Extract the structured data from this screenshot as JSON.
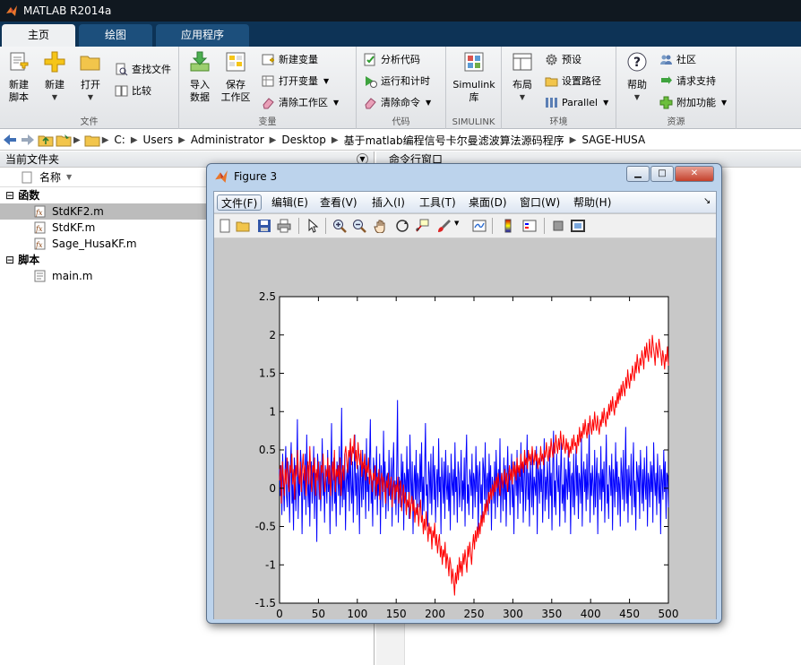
{
  "app": {
    "title": "MATLAB R2014a"
  },
  "ribbon": {
    "tabs": [
      "主页",
      "绘图",
      "应用程序"
    ],
    "sections": {
      "file": {
        "caption": "文件",
        "new_script": "新建\n脚本",
        "new": "新建",
        "open": "打开",
        "find_files": "查找文件",
        "compare": "比较"
      },
      "variable": {
        "caption": "变量",
        "import": "导入\n数据",
        "save_ws": "保存\n工作区",
        "new_var": "新建变量",
        "open_var": "打开变量",
        "clear_ws": "清除工作区"
      },
      "code": {
        "caption": "代码",
        "analyze": "分析代码",
        "run_time": "运行和计时",
        "clear_cmd": "清除命令"
      },
      "simulink": {
        "caption": "SIMULINK",
        "lib": "Simulink\n库"
      },
      "env": {
        "caption": "环境",
        "layout": "布局",
        "prefs": "预设",
        "set_path": "设置路径",
        "parallel": "Parallel"
      },
      "resources": {
        "caption": "资源",
        "help": "帮助",
        "community": "社区",
        "support": "请求支持",
        "addons": "附加功能"
      }
    }
  },
  "address": {
    "parts": [
      "C:",
      "Users",
      "Administrator",
      "Desktop",
      "基于matlab编程信号卡尔曼滤波算法源码程序",
      "SAGE-HUSA"
    ]
  },
  "file_panel": {
    "title": "当前文件夹",
    "col_name": "名称",
    "groups": [
      {
        "label": "函数",
        "items": [
          "StdKF2.m",
          "StdKF.m",
          "Sage_HusaKF.m"
        ]
      },
      {
        "label": "脚本",
        "items": [
          "main.m"
        ]
      }
    ]
  },
  "command_panel": {
    "title": "命令行窗口"
  },
  "figure": {
    "title": "Figure 3",
    "menu": [
      "文件(F)",
      "编辑(E)",
      "查看(V)",
      "插入(I)",
      "工具(T)",
      "桌面(D)",
      "窗口(W)",
      "帮助(H)"
    ]
  },
  "chart_data": {
    "type": "line",
    "xlim": [
      0,
      500
    ],
    "ylim": [
      -1.5,
      2.5
    ],
    "xticks": [
      0,
      50,
      100,
      150,
      200,
      250,
      300,
      350,
      400,
      450,
      500
    ],
    "yticks": [
      -1.5,
      -1,
      -0.5,
      0,
      0.5,
      1,
      1.5,
      2,
      2.5
    ],
    "series": [
      {
        "color": "#0000ff",
        "values": [
          0.25,
          -0.1,
          0.3,
          -0.35,
          0.45,
          0.05,
          -0.3,
          0.2,
          0.55,
          -0.1,
          -0.25,
          0.35,
          0.1,
          -0.45,
          0.3,
          0.6,
          -0.2,
          0.05,
          -0.55,
          0.4,
          0.2,
          -0.3,
          0.1,
          0.9,
          -0.4,
          0.15,
          -0.1,
          0.5,
          0.3,
          -0.6,
          0.05,
          0.2,
          -0.15,
          0.45,
          -0.35,
          0.7,
          0.1,
          -0.25,
          0.3,
          -0.5,
          0.15,
          0.35,
          -0.2,
          0.05,
          0.55,
          -0.4,
          0.2,
          0.1,
          -0.7,
          0.45,
          0.25,
          -0.15,
          0.35,
          -0.3,
          0.05,
          0.65,
          -0.1,
          0.2,
          -0.45,
          0.3,
          0.1,
          -0.2,
          0.5,
          -0.05,
          0.3,
          -0.6,
          0.15,
          0.85,
          -0.3,
          0.1,
          0.4,
          -0.2,
          0.05,
          -0.5,
          0.35,
          0.2,
          -0.1,
          0.55,
          -0.35,
          0.15,
          1.05,
          -0.25,
          0.3,
          -0.15,
          0.45,
          -0.55,
          0.1,
          0.25,
          -0.05,
          0.4,
          -0.3,
          0.6,
          0.05,
          -0.2,
          0.35,
          -0.45,
          0.15,
          0.7,
          -0.1,
          0.2,
          -0.35,
          0.3,
          0.1,
          -0.6,
          0.45,
          0.05,
          -0.25,
          0.5,
          -0.15,
          0.3,
          0.2,
          -0.4,
          0.65,
          -0.05,
          0.15,
          -0.3,
          0.35,
          0.9,
          -0.2,
          0.1,
          -0.5,
          0.4,
          0.25,
          -0.15,
          0.05,
          0.55,
          -0.35,
          0.2,
          -0.1,
          0.45,
          -0.6,
          0.3,
          0.1,
          -0.25,
          0.75,
          -0.05,
          0.35,
          -0.4,
          0.15,
          0.2,
          -0.3,
          0.5,
          0.05,
          -0.15,
          0.4,
          -0.5,
          0.25,
          0.6,
          -0.2,
          0.1,
          -0.35,
          0.3,
          1.15,
          -0.45,
          0.15,
          0.05,
          -0.25,
          0.45,
          -0.1,
          0.35,
          -0.55,
          0.2,
          0.1,
          -0.3,
          0.55,
          -0.05,
          0.25,
          -0.4,
          0.7,
          0.15,
          -0.2,
          0.35,
          -0.6,
          0.05,
          0.3,
          -0.15,
          0.5,
          -0.35,
          0.2,
          0.1,
          -0.25,
          0.45,
          -0.05,
          0.6,
          -0.4,
          0.15,
          -0.3,
          0.25,
          0.85,
          -0.1,
          0.05,
          -0.5,
          0.35,
          0.2,
          -0.2,
          0.45,
          -0.35,
          0.1,
          0.55,
          -0.15,
          0.3,
          -0.45,
          0.05,
          0.25,
          -0.25,
          0.65,
          -0.05,
          0.15,
          -0.6,
          0.4,
          0.1,
          -0.2,
          0.35,
          -0.4,
          0.5,
          0.05,
          -0.15,
          0.3,
          -0.3,
          0.2,
          -0.55,
          0.45,
          0.1,
          -0.1,
          0.25,
          -0.35,
          0.6,
          -0.05,
          0.15,
          -0.45,
          0.35,
          0.2,
          -0.25,
          0.05,
          0.5,
          -0.3,
          0.1,
          -0.15,
          0.4,
          -0.5,
          0.3,
          0.7,
          -0.2,
          0.05,
          -0.35,
          0.25,
          0.15,
          -0.1,
          0.45,
          -0.4,
          0.2,
          0.1,
          -0.25,
          0.55,
          -0.05,
          0.3,
          -0.6,
          0.15,
          0.35,
          -0.2,
          0.05,
          -0.45,
          0.4,
          0.25,
          -0.15,
          0.6,
          -0.3,
          0.1,
          0.2,
          -0.35,
          0.45,
          -0.05,
          0.3,
          -0.55,
          0.15,
          0.05,
          -0.2,
          0.35,
          -0.4,
          0.5,
          0.1,
          -0.25,
          0.25,
          -0.1,
          0.65,
          -0.45,
          0.2,
          0.05,
          -0.3,
          0.4,
          -0.15,
          0.3,
          -0.5,
          0.1,
          0.55,
          -0.05,
          0.2,
          -0.35,
          0.15,
          0.45,
          -0.25,
          0.05,
          -0.6,
          0.35,
          0.2,
          -0.1,
          0.5,
          -0.4,
          0.25,
          0.1,
          -0.2,
          0.6,
          -0.05,
          0.3,
          -0.45,
          0.15,
          0.4,
          -0.3,
          0.05,
          0.7,
          -0.15,
          0.2,
          -0.5,
          0.35,
          0.1,
          -0.25,
          0.45,
          -0.35,
          0.15,
          0.05,
          -0.1,
          0.55,
          -0.6,
          0.3,
          0.2,
          -0.2,
          0.4,
          -0.05,
          0.25,
          -0.45,
          0.1,
          0.65,
          -0.3,
          0.15,
          -0.15,
          0.35,
          0.05,
          -0.4,
          0.5,
          -0.1,
          0.2,
          -0.55,
          0.3,
          0.75,
          -0.25,
          0.1,
          -0.35,
          0.45,
          0.15,
          -0.05,
          0.3,
          -0.5,
          0.2,
          0.6,
          -0.2,
          0.05,
          -0.3,
          0.4,
          -0.45,
          0.25,
          0.1,
          -0.15,
          0.5,
          -0.05,
          0.35,
          -0.6,
          0.15,
          0.2,
          -0.25,
          0.45,
          -0.35,
          0.05,
          0.55,
          -0.1,
          0.3,
          -0.4,
          0.2,
          0.1,
          -0.2,
          0.65,
          -0.5,
          0.15,
          0.35,
          -0.05,
          0.25,
          -0.3,
          0.45,
          -0.15,
          0.1,
          0.85,
          -0.45,
          0.2,
          -0.1,
          0.3,
          0.05,
          -0.35,
          0.5,
          -0.25,
          0.15,
          0.4,
          -0.6,
          0.2,
          0.1,
          -0.15,
          0.55,
          -0.3,
          0.25,
          -0.05,
          0.35,
          -0.45,
          0.15,
          0.7,
          -0.2,
          0.05,
          -0.4,
          0.3,
          0.2,
          -0.1,
          0.45,
          -0.55,
          0.25,
          0.1,
          -0.25,
          0.6,
          -0.05,
          0.35,
          -0.35,
          0.15,
          0.05,
          -0.5,
          0.4,
          0.2,
          -0.15,
          0.5,
          -0.3,
          0.1,
          0.8,
          -0.2,
          0.25,
          -0.45,
          0.3,
          0.05,
          -0.1,
          0.45,
          -0.35,
          0.15,
          0.6,
          -0.25,
          0.1,
          -0.55,
          0.35,
          0.2,
          -0.05,
          0.3,
          -0.4,
          0.5,
          0.15,
          -0.2,
          0.25,
          -0.3,
          0.4,
          0.05,
          -0.15,
          0.55,
          -0.5,
          0.2,
          0.1,
          -0.25,
          0.35,
          -0.05,
          0.3,
          -0.45,
          0.6,
          0.15,
          -0.1,
          0.2,
          -0.35,
          0.45,
          0.05,
          -0.2,
          0.3,
          -0.6,
          0.25,
          0.1,
          -0.15,
          0.5,
          -0.05,
          0.35,
          -0.4,
          0.2,
          0.15,
          -0.25
        ]
      },
      {
        "color": "#ff0000",
        "values": [
          0.1,
          0.3,
          -0.2,
          0.35,
          0.15,
          -0.1,
          0.25,
          0.05,
          0.4,
          0.1,
          -0.05,
          0.3,
          0.2,
          0.45,
          0.05,
          0.25,
          -0.15,
          0.3,
          0.15,
          0.5,
          0.2,
          0.05,
          0.35,
          -0.05,
          0.25,
          0.45,
          0.1,
          0.3,
          -0.1,
          0.2,
          0.35,
          0.05,
          0.55,
          0.15,
          -0.05,
          0.3,
          0.2,
          0.4,
          -0.1,
          0.25,
          0.1,
          0.35,
          0.05,
          -0.15,
          0.3,
          0.2,
          0.45,
          0.1,
          -0.05,
          0.25,
          0.15,
          0.4,
          0.05,
          0.3,
          -0.1,
          0.2,
          0.35,
          0.1,
          0.5,
          -0.05,
          0.25,
          0.15,
          0.3,
          0.05,
          0.4,
          -0.1,
          0.2,
          0.3,
          0.1,
          0.45,
          0.55,
          0.35,
          0.2,
          0.5,
          0.4,
          0.65,
          0.3,
          0.55,
          0.45,
          0.7,
          0.35,
          0.5,
          0.25,
          0.6,
          0.4,
          0.3,
          0.5,
          0.15,
          0.35,
          0.25,
          0.45,
          0.1,
          0.3,
          0.2,
          0.4,
          0.05,
          0.25,
          0.15,
          -0.05,
          0.2,
          0.1,
          0.3,
          -0.1,
          0.15,
          0.05,
          0.25,
          -0.15,
          0.1,
          0.2,
          -0.05,
          0.15,
          0.05,
          -0.2,
          0.1,
          0.0,
          0.2,
          -0.1,
          0.05,
          0.15,
          -0.25,
          0.0,
          0.1,
          -0.15,
          0.05,
          -0.05,
          0.15,
          -0.2,
          0.0,
          0.1,
          -0.3,
          -0.1,
          0.05,
          -0.2,
          -0.05,
          -0.35,
          -0.15,
          -0.25,
          -0.05,
          -0.4,
          -0.2,
          -0.1,
          -0.3,
          -0.15,
          -0.45,
          -0.25,
          -0.35,
          -0.2,
          -0.5,
          -0.3,
          -0.15,
          -0.45,
          -0.35,
          -0.6,
          -0.4,
          -0.55,
          -0.3,
          -0.5,
          -0.7,
          -0.45,
          -0.6,
          -0.5,
          -0.8,
          -0.55,
          -0.65,
          -0.45,
          -0.75,
          -0.6,
          -0.85,
          -0.7,
          -0.6,
          -0.9,
          -0.75,
          -1.0,
          -0.8,
          -0.9,
          -0.7,
          -1.05,
          -0.85,
          -0.95,
          -1.15,
          -0.9,
          -1.0,
          -1.25,
          -1.05,
          -1.2,
          -1.4,
          -1.1,
          -1.25,
          -1.0,
          -1.2,
          -0.9,
          -1.1,
          -0.95,
          -1.15,
          -0.85,
          -1.0,
          -0.8,
          -0.95,
          -1.1,
          -0.75,
          -0.9,
          -0.7,
          -0.85,
          -1.0,
          -0.75,
          -0.6,
          -0.8,
          -0.55,
          -0.7,
          -0.5,
          -0.65,
          -0.45,
          -0.6,
          -0.35,
          -0.5,
          -0.3,
          -0.45,
          -0.2,
          -0.35,
          -0.15,
          -0.3,
          -0.05,
          -0.2,
          0.0,
          -0.15,
          0.05,
          -0.1,
          0.1,
          -0.05,
          0.15,
          0.0,
          0.2,
          0.05,
          -0.1,
          0.1,
          0.2,
          0.0,
          0.15,
          0.25,
          0.05,
          0.2,
          -0.05,
          0.15,
          0.3,
          0.1,
          0.25,
          0.05,
          0.35,
          0.15,
          0.3,
          0.1,
          0.4,
          0.2,
          0.3,
          0.15,
          0.45,
          0.25,
          0.35,
          0.2,
          0.5,
          0.3,
          0.4,
          0.25,
          0.5,
          0.35,
          0.45,
          0.3,
          0.55,
          0.4,
          0.3,
          0.5,
          0.35,
          0.45,
          0.25,
          0.4,
          0.3,
          0.55,
          0.35,
          0.45,
          0.3,
          0.5,
          0.4,
          0.6,
          0.45,
          0.35,
          0.55,
          0.4,
          0.65,
          0.5,
          0.4,
          0.6,
          0.45,
          0.7,
          0.55,
          0.45,
          0.65,
          0.5,
          0.75,
          0.6,
          0.5,
          0.7,
          0.55,
          0.45,
          0.65,
          0.5,
          0.6,
          0.4,
          0.55,
          0.45,
          0.65,
          0.5,
          0.7,
          0.55,
          0.6,
          0.45,
          0.7,
          0.55,
          0.8,
          0.6,
          0.75,
          0.65,
          0.85,
          0.7,
          0.9,
          0.75,
          0.65,
          0.85,
          0.7,
          0.95,
          0.8,
          0.7,
          0.9,
          0.75,
          1.0,
          0.85,
          0.75,
          0.95,
          0.8,
          0.7,
          0.9,
          0.8,
          1.0,
          0.85,
          1.05,
          0.9,
          0.8,
          1.0,
          0.9,
          1.1,
          0.95,
          1.15,
          1.0,
          1.2,
          1.05,
          0.95,
          1.15,
          1.05,
          1.25,
          1.1,
          1.3,
          1.15,
          1.35,
          1.2,
          1.4,
          1.3,
          1.2,
          1.45,
          1.3,
          1.55,
          1.4,
          1.3,
          1.5,
          1.4,
          1.6,
          1.5,
          1.4,
          1.65,
          1.5,
          1.75,
          1.6,
          1.5,
          1.7,
          1.6,
          1.8,
          1.7,
          1.55,
          1.85,
          1.7,
          1.9,
          1.75,
          1.65,
          1.95,
          1.8,
          1.7,
          2.0,
          1.85,
          1.75,
          1.6,
          1.9,
          1.8,
          1.7,
          1.95,
          1.85,
          1.75,
          1.6,
          1.8,
          1.7,
          1.55,
          1.75,
          1.65,
          1.85,
          1.6
        ]
      }
    ]
  }
}
